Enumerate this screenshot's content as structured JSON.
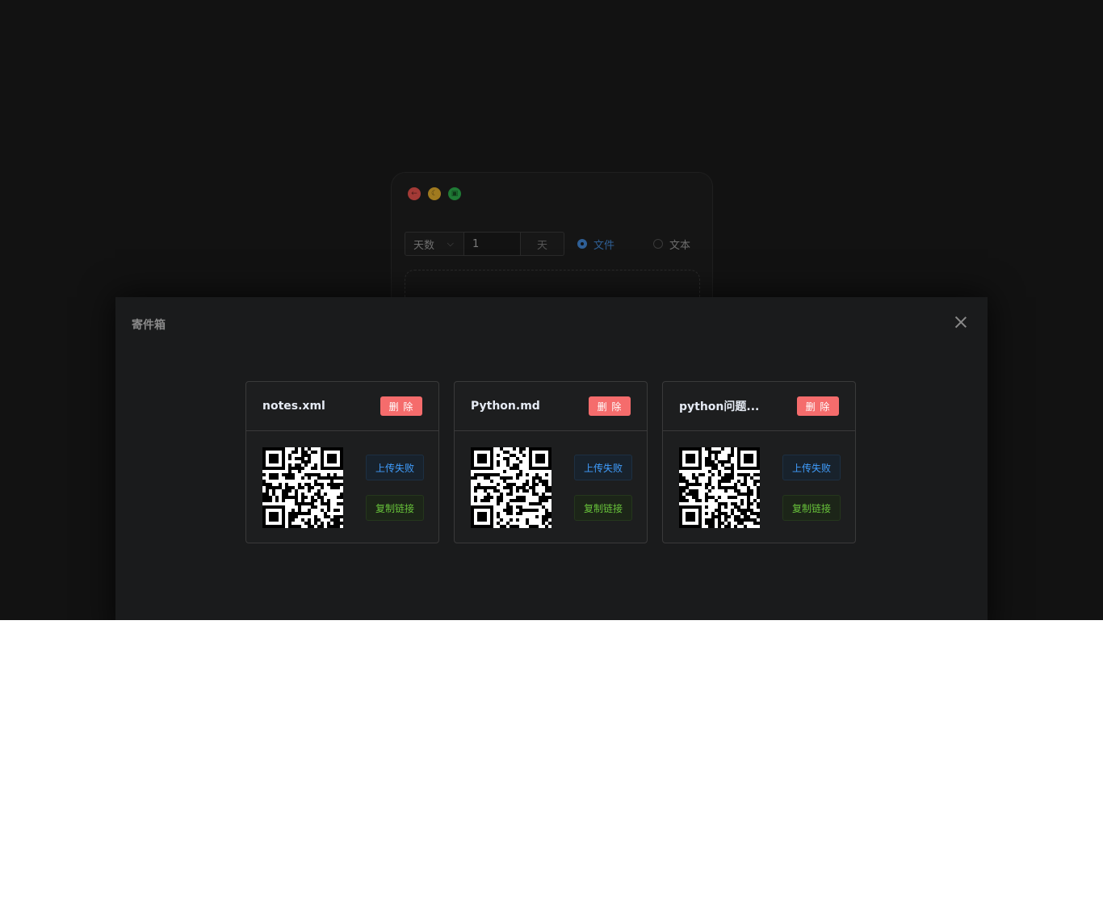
{
  "app": {
    "window_buttons": [
      {
        "name": "back",
        "glyph": "←",
        "color": "#a33a36"
      },
      {
        "name": "theme",
        "glyph": "☾",
        "color": "#a07a1f"
      },
      {
        "name": "outbox",
        "glyph": "▣",
        "color": "#1f7a35"
      }
    ],
    "expire_select": "天数",
    "expire_value": "1",
    "expire_unit": "天",
    "radio_file": "文件",
    "radio_text": "文本",
    "selected_type": "文件"
  },
  "modal": {
    "title": "寄件箱",
    "cards": [
      {
        "name": "notes.xml",
        "delete_label": "删 除",
        "status_label": "上传失败",
        "copy_label": "复制链接"
      },
      {
        "name": "Python.md",
        "delete_label": "删 除",
        "status_label": "上传失败",
        "copy_label": "复制链接"
      },
      {
        "name": "python问题...",
        "delete_label": "删 除",
        "status_label": "上传失败",
        "copy_label": "复制链接"
      }
    ]
  },
  "colors": {
    "danger": "#f56c6c",
    "primary": "#409eff",
    "success": "#67c23a",
    "background": "#121212"
  }
}
